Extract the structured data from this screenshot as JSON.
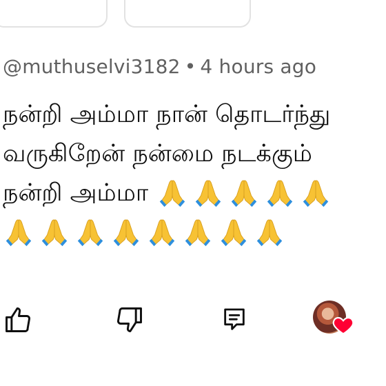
{
  "comment": {
    "author": "@muthuselvi3182",
    "separator": "•",
    "time": "4 hours ago",
    "lines": [
      "நன்றி அம்மா நான் தொடர்ந்து",
      "வருகிறேன் நன்மை நடக்கும்",
      "நன்றி அம்மா"
    ],
    "emoji_line3_count": 5,
    "emoji_line4_count": 8,
    "emoji": "folded-hands"
  },
  "actions": {
    "like_icon": "thumbs-up-icon",
    "dislike_icon": "thumbs-down-icon",
    "reply_icon": "reply-comment-icon",
    "creator_heart_icon": "creator-heart-icon"
  },
  "colors": {
    "text": "#0f0f0f",
    "meta": "#606060",
    "heart": "#ff0033",
    "emoji_skin": "#f7c234",
    "emoji_sleeve": "#2e8fdd"
  }
}
